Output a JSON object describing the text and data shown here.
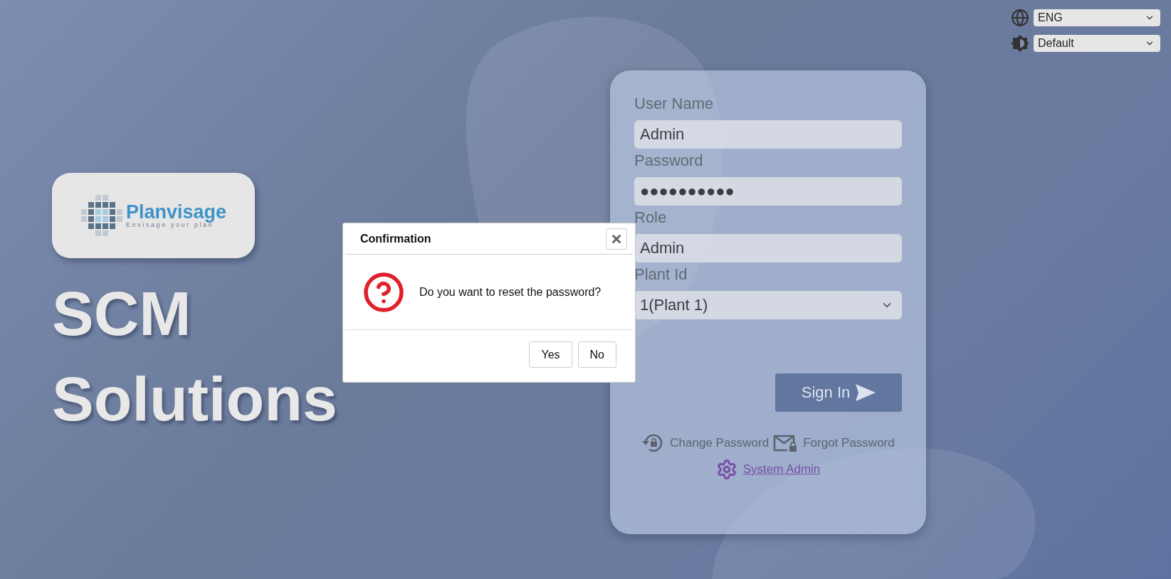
{
  "language_select": {
    "value": "ENG"
  },
  "theme_select": {
    "value": "Default"
  },
  "logo": {
    "name": "Planvisage",
    "tagline": "Envisage your plan"
  },
  "headline": [
    "SCM",
    "Solutions"
  ],
  "login": {
    "fields": [
      {
        "kind": "text",
        "label": "User Name",
        "value": "Admin"
      },
      {
        "kind": "password",
        "label": "Password",
        "value": "●●●●●●●●●●"
      },
      {
        "kind": "text",
        "label": "Role",
        "value": "Admin"
      },
      {
        "kind": "select",
        "label": "Plant Id",
        "value": "1(Plant 1)"
      }
    ],
    "sign_in": "Sign In",
    "links": [
      {
        "kind": "change_password",
        "label": "Change Password"
      },
      {
        "kind": "forgot_password",
        "label": "Forgot Password"
      }
    ],
    "admin_link": {
      "label": "System Admin"
    }
  },
  "dialog": {
    "title": "Confirmation",
    "message": "Do you want to reset the password?",
    "buttons": [
      "Yes",
      "No"
    ]
  }
}
